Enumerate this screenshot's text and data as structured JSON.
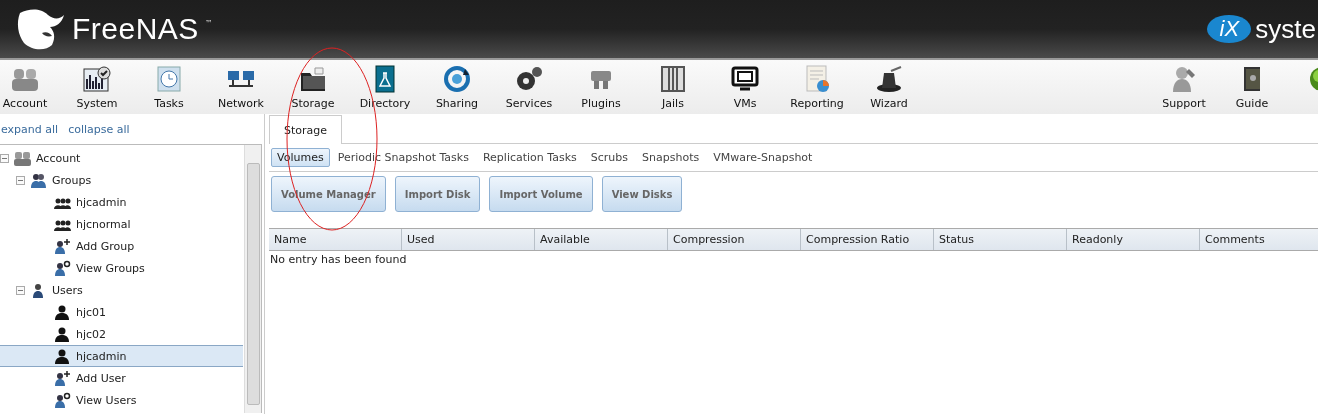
{
  "header": {
    "logo_text": "FreeNAS",
    "logo_mark": "™",
    "partner_badge": "iX",
    "partner_text": "syste"
  },
  "toolbar": {
    "items": [
      {
        "label": "Account",
        "kind": "account"
      },
      {
        "label": "System",
        "kind": "system"
      },
      {
        "label": "Tasks",
        "kind": "tasks"
      },
      {
        "label": "Network",
        "kind": "network"
      },
      {
        "label": "Storage",
        "kind": "storage"
      },
      {
        "label": "Directory",
        "kind": "directory"
      },
      {
        "label": "Sharing",
        "kind": "sharing"
      },
      {
        "label": "Services",
        "kind": "services"
      },
      {
        "label": "Plugins",
        "kind": "plugins"
      },
      {
        "label": "Jails",
        "kind": "jails"
      },
      {
        "label": "VMs",
        "kind": "vms"
      },
      {
        "label": "Reporting",
        "kind": "reporting"
      },
      {
        "label": "Wizard",
        "kind": "wizard"
      }
    ],
    "right_items": [
      {
        "label": "Support",
        "kind": "support"
      },
      {
        "label": "Guide",
        "kind": "guide"
      },
      {
        "kind": "globe"
      }
    ]
  },
  "sidebar": {
    "links": [
      "expand all",
      "collapse all"
    ],
    "tree": [
      {
        "label": "Account",
        "kind": "account",
        "expanded": true,
        "selected": false,
        "children": [
          {
            "label": "Groups",
            "kind": "groups",
            "expanded": true,
            "selected": false,
            "children": [
              {
                "label": "hjcadmin",
                "kind": "group",
                "selected": false
              },
              {
                "label": "hjcnormal",
                "kind": "group",
                "selected": false
              },
              {
                "label": "Add Group",
                "kind": "add",
                "selected": false
              },
              {
                "label": "View Groups",
                "kind": "view",
                "selected": false
              }
            ]
          },
          {
            "label": "Users",
            "kind": "users",
            "expanded": true,
            "selected": false,
            "children": [
              {
                "label": "hjc01",
                "kind": "user",
                "selected": false
              },
              {
                "label": "hjc02",
                "kind": "user",
                "selected": false
              },
              {
                "label": "hjcadmin",
                "kind": "user",
                "selected": true
              },
              {
                "label": "Add User",
                "kind": "add",
                "selected": false
              },
              {
                "label": "View Users",
                "kind": "view",
                "selected": false
              }
            ]
          }
        ]
      }
    ]
  },
  "main": {
    "tabs": [
      {
        "label": "Storage",
        "selected": true
      }
    ],
    "subtabs": [
      {
        "label": "Volumes",
        "selected": true
      },
      {
        "label": "Periodic Snapshot Tasks",
        "selected": false
      },
      {
        "label": "Replication Tasks",
        "selected": false
      },
      {
        "label": "Scrubs",
        "selected": false
      },
      {
        "label": "Snapshots",
        "selected": false
      },
      {
        "label": "VMware-Snapshot",
        "selected": false
      }
    ],
    "buttons": [
      "Volume Manager",
      "Import Disk",
      "Import Volume",
      "View Disks"
    ],
    "table": {
      "columns": [
        "Name",
        "Used",
        "Available",
        "Compression",
        "Compression Ratio",
        "Status",
        "Readonly",
        "Comments"
      ],
      "empty_message": "No entry has been found"
    }
  }
}
